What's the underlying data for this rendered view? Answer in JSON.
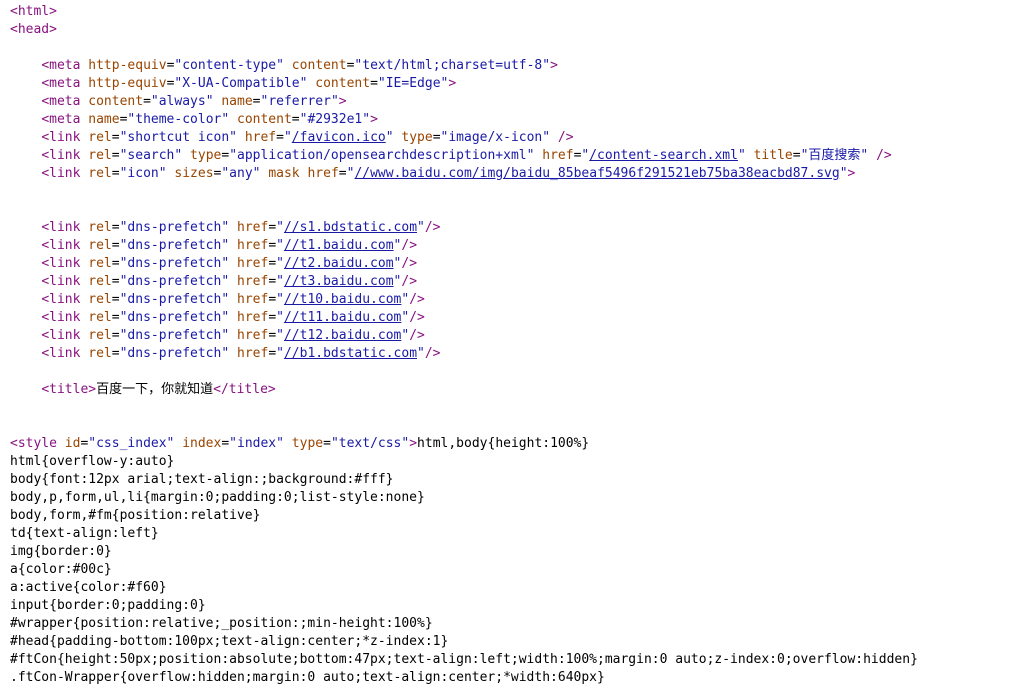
{
  "source_lines": [
    [
      [
        "t",
        "<html>"
      ]
    ],
    [
      [
        "t",
        "<head>"
      ]
    ],
    [],
    [
      [
        "p",
        "    "
      ],
      [
        "t",
        "<meta "
      ],
      [
        "a",
        "http-equiv"
      ],
      [
        "p",
        "="
      ],
      [
        "v",
        "\"content-type\""
      ],
      [
        "p",
        " "
      ],
      [
        "a",
        "content"
      ],
      [
        "p",
        "="
      ],
      [
        "v",
        "\"text/html;charset=utf-8\""
      ],
      [
        "t",
        ">"
      ]
    ],
    [
      [
        "p",
        "    "
      ],
      [
        "t",
        "<meta "
      ],
      [
        "a",
        "http-equiv"
      ],
      [
        "p",
        "="
      ],
      [
        "v",
        "\"X-UA-Compatible\""
      ],
      [
        "p",
        " "
      ],
      [
        "a",
        "content"
      ],
      [
        "p",
        "="
      ],
      [
        "v",
        "\"IE=Edge\""
      ],
      [
        "t",
        ">"
      ]
    ],
    [
      [
        "p",
        "    "
      ],
      [
        "t",
        "<meta "
      ],
      [
        "a",
        "content"
      ],
      [
        "p",
        "="
      ],
      [
        "v",
        "\"always\""
      ],
      [
        "p",
        " "
      ],
      [
        "a",
        "name"
      ],
      [
        "p",
        "="
      ],
      [
        "v",
        "\"referrer\""
      ],
      [
        "t",
        ">"
      ]
    ],
    [
      [
        "p",
        "    "
      ],
      [
        "t",
        "<meta "
      ],
      [
        "a",
        "name"
      ],
      [
        "p",
        "="
      ],
      [
        "v",
        "\"theme-color\""
      ],
      [
        "p",
        " "
      ],
      [
        "a",
        "content"
      ],
      [
        "p",
        "="
      ],
      [
        "v",
        "\"#2932e1\""
      ],
      [
        "t",
        ">"
      ]
    ],
    [
      [
        "p",
        "    "
      ],
      [
        "t",
        "<link "
      ],
      [
        "a",
        "rel"
      ],
      [
        "p",
        "="
      ],
      [
        "v",
        "\"shortcut icon\""
      ],
      [
        "p",
        " "
      ],
      [
        "a",
        "href"
      ],
      [
        "p",
        "="
      ],
      [
        "v",
        "\""
      ],
      [
        "l",
        "/favicon.ico"
      ],
      [
        "v",
        "\""
      ],
      [
        "p",
        " "
      ],
      [
        "a",
        "type"
      ],
      [
        "p",
        "="
      ],
      [
        "v",
        "\"image/x-icon\""
      ],
      [
        "p",
        " "
      ],
      [
        "t",
        "/>"
      ]
    ],
    [
      [
        "p",
        "    "
      ],
      [
        "t",
        "<link "
      ],
      [
        "a",
        "rel"
      ],
      [
        "p",
        "="
      ],
      [
        "v",
        "\"search\""
      ],
      [
        "p",
        " "
      ],
      [
        "a",
        "type"
      ],
      [
        "p",
        "="
      ],
      [
        "v",
        "\"application/opensearchdescription+xml\""
      ],
      [
        "p",
        " "
      ],
      [
        "a",
        "href"
      ],
      [
        "p",
        "="
      ],
      [
        "v",
        "\""
      ],
      [
        "l",
        "/content-search.xml"
      ],
      [
        "v",
        "\""
      ],
      [
        "p",
        " "
      ],
      [
        "a",
        "title"
      ],
      [
        "p",
        "="
      ],
      [
        "v",
        "\"百度搜索\""
      ],
      [
        "p",
        " "
      ],
      [
        "t",
        "/>"
      ]
    ],
    [
      [
        "p",
        "    "
      ],
      [
        "t",
        "<link "
      ],
      [
        "a",
        "rel"
      ],
      [
        "p",
        "="
      ],
      [
        "v",
        "\"icon\""
      ],
      [
        "p",
        " "
      ],
      [
        "a",
        "sizes"
      ],
      [
        "p",
        "="
      ],
      [
        "v",
        "\"any\""
      ],
      [
        "p",
        " "
      ],
      [
        "a",
        "mask"
      ],
      [
        "p",
        " "
      ],
      [
        "a",
        "href"
      ],
      [
        "p",
        "="
      ],
      [
        "v",
        "\""
      ],
      [
        "l",
        "//www.baidu.com/img/baidu_85beaf5496f291521eb75ba38eacbd87.svg"
      ],
      [
        "v",
        "\""
      ],
      [
        "t",
        ">"
      ]
    ],
    [],
    [],
    [
      [
        "p",
        "    "
      ],
      [
        "t",
        "<link "
      ],
      [
        "a",
        "rel"
      ],
      [
        "p",
        "="
      ],
      [
        "v",
        "\"dns-prefetch\""
      ],
      [
        "p",
        " "
      ],
      [
        "a",
        "href"
      ],
      [
        "p",
        "="
      ],
      [
        "v",
        "\""
      ],
      [
        "l",
        "//s1.bdstatic.com"
      ],
      [
        "v",
        "\""
      ],
      [
        "t",
        "/>"
      ]
    ],
    [
      [
        "p",
        "    "
      ],
      [
        "t",
        "<link "
      ],
      [
        "a",
        "rel"
      ],
      [
        "p",
        "="
      ],
      [
        "v",
        "\"dns-prefetch\""
      ],
      [
        "p",
        " "
      ],
      [
        "a",
        "href"
      ],
      [
        "p",
        "="
      ],
      [
        "v",
        "\""
      ],
      [
        "l",
        "//t1.baidu.com"
      ],
      [
        "v",
        "\""
      ],
      [
        "t",
        "/>"
      ]
    ],
    [
      [
        "p",
        "    "
      ],
      [
        "t",
        "<link "
      ],
      [
        "a",
        "rel"
      ],
      [
        "p",
        "="
      ],
      [
        "v",
        "\"dns-prefetch\""
      ],
      [
        "p",
        " "
      ],
      [
        "a",
        "href"
      ],
      [
        "p",
        "="
      ],
      [
        "v",
        "\""
      ],
      [
        "l",
        "//t2.baidu.com"
      ],
      [
        "v",
        "\""
      ],
      [
        "t",
        "/>"
      ]
    ],
    [
      [
        "p",
        "    "
      ],
      [
        "t",
        "<link "
      ],
      [
        "a",
        "rel"
      ],
      [
        "p",
        "="
      ],
      [
        "v",
        "\"dns-prefetch\""
      ],
      [
        "p",
        " "
      ],
      [
        "a",
        "href"
      ],
      [
        "p",
        "="
      ],
      [
        "v",
        "\""
      ],
      [
        "l",
        "//t3.baidu.com"
      ],
      [
        "v",
        "\""
      ],
      [
        "t",
        "/>"
      ]
    ],
    [
      [
        "p",
        "    "
      ],
      [
        "t",
        "<link "
      ],
      [
        "a",
        "rel"
      ],
      [
        "p",
        "="
      ],
      [
        "v",
        "\"dns-prefetch\""
      ],
      [
        "p",
        " "
      ],
      [
        "a",
        "href"
      ],
      [
        "p",
        "="
      ],
      [
        "v",
        "\""
      ],
      [
        "l",
        "//t10.baidu.com"
      ],
      [
        "v",
        "\""
      ],
      [
        "t",
        "/>"
      ]
    ],
    [
      [
        "p",
        "    "
      ],
      [
        "t",
        "<link "
      ],
      [
        "a",
        "rel"
      ],
      [
        "p",
        "="
      ],
      [
        "v",
        "\"dns-prefetch\""
      ],
      [
        "p",
        " "
      ],
      [
        "a",
        "href"
      ],
      [
        "p",
        "="
      ],
      [
        "v",
        "\""
      ],
      [
        "l",
        "//t11.baidu.com"
      ],
      [
        "v",
        "\""
      ],
      [
        "t",
        "/>"
      ]
    ],
    [
      [
        "p",
        "    "
      ],
      [
        "t",
        "<link "
      ],
      [
        "a",
        "rel"
      ],
      [
        "p",
        "="
      ],
      [
        "v",
        "\"dns-prefetch\""
      ],
      [
        "p",
        " "
      ],
      [
        "a",
        "href"
      ],
      [
        "p",
        "="
      ],
      [
        "v",
        "\""
      ],
      [
        "l",
        "//t12.baidu.com"
      ],
      [
        "v",
        "\""
      ],
      [
        "t",
        "/>"
      ]
    ],
    [
      [
        "p",
        "    "
      ],
      [
        "t",
        "<link "
      ],
      [
        "a",
        "rel"
      ],
      [
        "p",
        "="
      ],
      [
        "v",
        "\"dns-prefetch\""
      ],
      [
        "p",
        " "
      ],
      [
        "a",
        "href"
      ],
      [
        "p",
        "="
      ],
      [
        "v",
        "\""
      ],
      [
        "l",
        "//b1.bdstatic.com"
      ],
      [
        "v",
        "\""
      ],
      [
        "t",
        "/>"
      ]
    ],
    [],
    [
      [
        "p",
        "    "
      ],
      [
        "t",
        "<title>"
      ],
      [
        "p",
        "百度一下，你就知道"
      ],
      [
        "t",
        "</title>"
      ]
    ],
    [],
    [],
    [
      [
        "t",
        "<style "
      ],
      [
        "a",
        "id"
      ],
      [
        "p",
        "="
      ],
      [
        "v",
        "\"css_index\""
      ],
      [
        "p",
        " "
      ],
      [
        "a",
        "index"
      ],
      [
        "p",
        "="
      ],
      [
        "v",
        "\"index\""
      ],
      [
        "p",
        " "
      ],
      [
        "a",
        "type"
      ],
      [
        "p",
        "="
      ],
      [
        "v",
        "\"text/css\""
      ],
      [
        "t",
        ">"
      ],
      [
        "p",
        "html,body{height:100%}"
      ]
    ],
    [
      [
        "p",
        "html{overflow-y:auto}"
      ]
    ],
    [
      [
        "p",
        "body{font:12px arial;text-align:;background:#fff}"
      ]
    ],
    [
      [
        "p",
        "body,p,form,ul,li{margin:0;padding:0;list-style:none}"
      ]
    ],
    [
      [
        "p",
        "body,form,#fm{position:relative}"
      ]
    ],
    [
      [
        "p",
        "td{text-align:left}"
      ]
    ],
    [
      [
        "p",
        "img{border:0}"
      ]
    ],
    [
      [
        "p",
        "a{color:#00c}"
      ]
    ],
    [
      [
        "p",
        "a:active{color:#f60}"
      ]
    ],
    [
      [
        "p",
        "input{border:0;padding:0}"
      ]
    ],
    [
      [
        "p",
        "#wrapper{position:relative;_position:;min-height:100%}"
      ]
    ],
    [
      [
        "p",
        "#head{padding-bottom:100px;text-align:center;*z-index:1}"
      ]
    ],
    [
      [
        "p",
        "#ftCon{height:50px;position:absolute;bottom:47px;text-align:left;width:100%;margin:0 auto;z-index:0;overflow:hidden}"
      ]
    ],
    [
      [
        "p",
        ".ftCon-Wrapper{overflow:hidden;margin:0 auto;text-align:center;*width:640px}"
      ]
    ]
  ]
}
